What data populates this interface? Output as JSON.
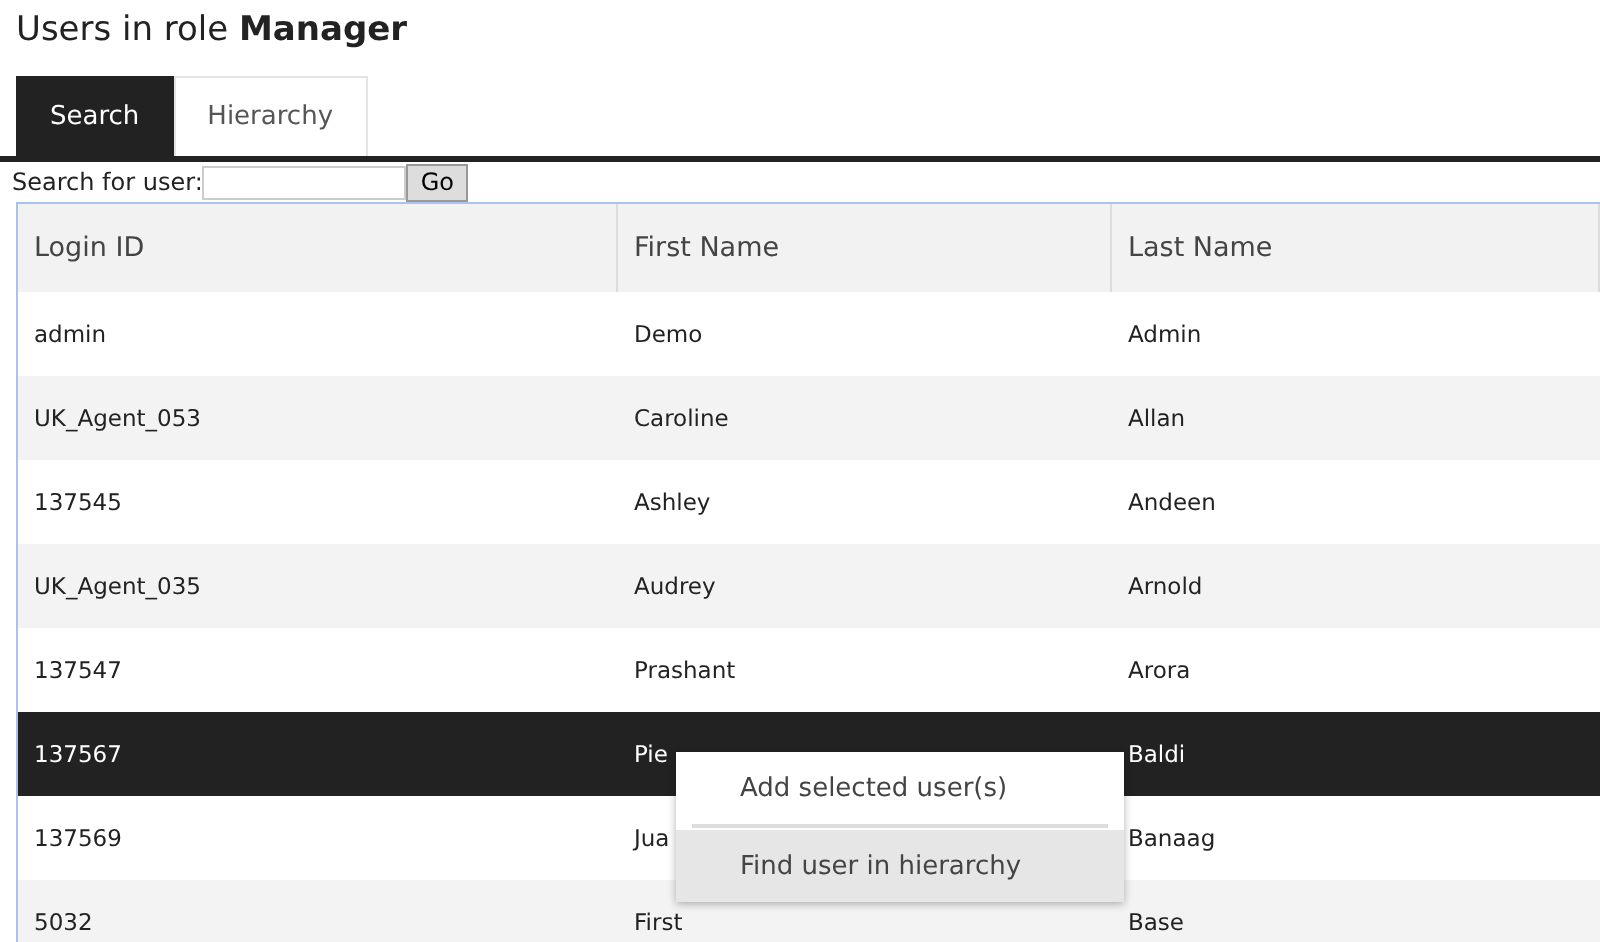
{
  "title": "Users in role **Manager**",
  "tabs": [
    {
      "label": "Search",
      "selected": true
    },
    {
      "label": "Hierarchy",
      "selected": false
    }
  ],
  "search": {
    "label": "Search for user:",
    "button": "Go"
  },
  "table": {
    "columns": [
      "Login ID",
      "First Name",
      "Last Name"
    ],
    "rows": [
      {
        "cells": [
          "admin",
          "Demo",
          "Admin"
        ],
        "selected": false
      },
      {
        "cells": [
          "UK_Agent_053",
          "Caroline",
          "Allan"
        ],
        "selected": false
      },
      {
        "cells": [
          "137545",
          "Ashley",
          "Andeen"
        ],
        "selected": false
      },
      {
        "cells": [
          "UK_Agent_035",
          "Audrey",
          "Arnold"
        ],
        "selected": false
      },
      {
        "cells": [
          "137547",
          "Prashant",
          "Arora"
        ],
        "selected": false
      },
      {
        "cells": [
          "137567",
          "Pie",
          "Baldi"
        ],
        "selected": true
      },
      {
        "cells": [
          "137569",
          "Jua",
          "Banaag"
        ],
        "selected": false
      },
      {
        "cells": [
          "5032",
          "First",
          "Base"
        ],
        "selected": false
      }
    ]
  },
  "context_menu": {
    "items": [
      {
        "label": "Add selected user(s)",
        "highlighted": false
      },
      {
        "label": "Find user in hierarchy",
        "highlighted": true
      }
    ]
  }
}
